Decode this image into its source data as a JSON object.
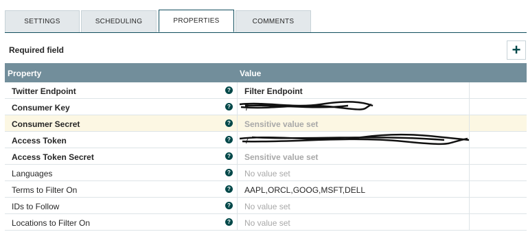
{
  "tabs": [
    {
      "label": "SETTINGS",
      "active": false
    },
    {
      "label": "SCHEDULING",
      "active": false
    },
    {
      "label": "PROPERTIES",
      "active": true
    },
    {
      "label": "COMMENTS",
      "active": false
    }
  ],
  "required_label": "Required field",
  "add_button": "+",
  "grid": {
    "header_property": "Property",
    "header_value": "Value",
    "rows": [
      {
        "name": "Twitter Endpoint",
        "required": true,
        "value": "Filter Endpoint",
        "value_style": "bold",
        "highlighted": false
      },
      {
        "name": "Consumer Key",
        "required": true,
        "value": "7",
        "value_style": "redacted",
        "highlighted": false
      },
      {
        "name": "Consumer Secret",
        "required": true,
        "value": "Sensitive value set",
        "value_style": "sensitive",
        "highlighted": true
      },
      {
        "name": "Access Token",
        "required": true,
        "value": "7",
        "value_style": "redacted",
        "highlighted": false
      },
      {
        "name": "Access Token Secret",
        "required": true,
        "value": "Sensitive value set",
        "value_style": "sensitive",
        "highlighted": false
      },
      {
        "name": "Languages",
        "required": false,
        "value": "No value set",
        "value_style": "none",
        "highlighted": false
      },
      {
        "name": "Terms to Filter On",
        "required": false,
        "value": "AAPL,ORCL,GOOG,MSFT,DELL",
        "value_style": "plain",
        "highlighted": false
      },
      {
        "name": "IDs to Follow",
        "required": false,
        "value": "No value set",
        "value_style": "none",
        "highlighted": false
      },
      {
        "name": "Locations to Filter On",
        "required": false,
        "value": "No value set",
        "value_style": "none",
        "highlighted": false
      }
    ]
  },
  "help_icon_glyph": "?"
}
